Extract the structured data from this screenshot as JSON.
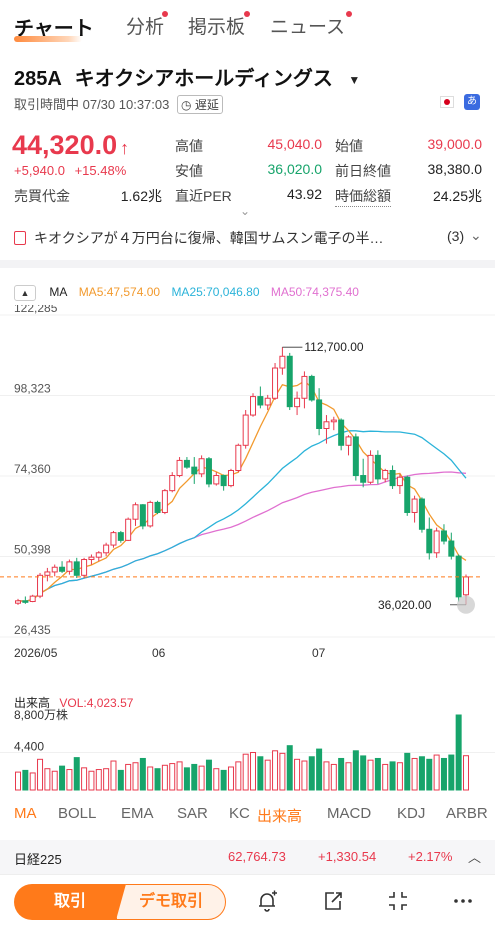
{
  "tabs": [
    {
      "label": "チャート",
      "active": true,
      "dot": false
    },
    {
      "label": "分析",
      "active": false,
      "dot": true
    },
    {
      "label": "掲示板",
      "active": false,
      "dot": true
    },
    {
      "label": "ニュース",
      "active": false,
      "dot": true
    }
  ],
  "stock": {
    "code": "285A",
    "name": "キオクシアホールディングス",
    "status": "取引時間中 07/30 10:37:03",
    "delay_label": "遅延",
    "price": "44,320.0",
    "change": "+5,940.0",
    "change_pct": "+15.48%",
    "turnover_label": "売買代金",
    "turnover": "1.62兆"
  },
  "stats": {
    "high_label": "高値",
    "high": "45,040.0",
    "open_label": "始値",
    "open": "39,000.0",
    "low_label": "安値",
    "low": "36,020.0",
    "prev_close_label": "前日終値",
    "prev_close": "38,380.0",
    "per_label": "直近PER",
    "per": "43.92",
    "mcap_label": "時価総額",
    "mcap": "24.25兆"
  },
  "news": {
    "text": "キオクシアが４万円台に復帰、韓国サムスン電子の半…",
    "count": "(3)"
  },
  "ma_legend": {
    "toggle": "MA",
    "ma5": "MA5:47,574.00",
    "ma25": "MA25:70,046.80",
    "ma50": "MA50:74,375.40"
  },
  "colors": {
    "up": "#e8394d",
    "down": "#17a46b",
    "ma5": "#f29a2e",
    "ma25": "#2bb3d9",
    "ma50": "#e070d0",
    "accent": "#ff7a1a"
  },
  "chart_data": {
    "type": "candlestick",
    "y_ticks": [
      "122,285",
      "98,323",
      "74,360",
      "50,398",
      "26,435"
    ],
    "x_ticks": [
      "2026/05",
      "06",
      "07"
    ],
    "max_label": "112,700.00",
    "min_label": "36,020.00",
    "last_price": 44320,
    "candles": [
      {
        "o": 36500,
        "h": 37800,
        "l": 36000,
        "c": 37200
      },
      {
        "o": 37200,
        "h": 38500,
        "l": 36300,
        "c": 37000
      },
      {
        "o": 37000,
        "h": 39000,
        "l": 36800,
        "c": 38600
      },
      {
        "o": 38600,
        "h": 45500,
        "l": 38000,
        "c": 44800
      },
      {
        "o": 44800,
        "h": 47000,
        "l": 43000,
        "c": 45800
      },
      {
        "o": 45800,
        "h": 48000,
        "l": 44500,
        "c": 47200
      },
      {
        "o": 47200,
        "h": 49000,
        "l": 45500,
        "c": 46000
      },
      {
        "o": 46000,
        "h": 49500,
        "l": 45000,
        "c": 48800
      },
      {
        "o": 48800,
        "h": 50000,
        "l": 44000,
        "c": 44800
      },
      {
        "o": 44800,
        "h": 50000,
        "l": 44000,
        "c": 49500
      },
      {
        "o": 49500,
        "h": 51000,
        "l": 48000,
        "c": 50200
      },
      {
        "o": 50200,
        "h": 52000,
        "l": 49000,
        "c": 51500
      },
      {
        "o": 51500,
        "h": 54500,
        "l": 50500,
        "c": 53800
      },
      {
        "o": 53800,
        "h": 58000,
        "l": 53000,
        "c": 57500
      },
      {
        "o": 57500,
        "h": 58000,
        "l": 54500,
        "c": 55200
      },
      {
        "o": 55200,
        "h": 62000,
        "l": 55000,
        "c": 61500
      },
      {
        "o": 61500,
        "h": 66500,
        "l": 59500,
        "c": 65800
      },
      {
        "o": 65800,
        "h": 66000,
        "l": 58500,
        "c": 59500
      },
      {
        "o": 59500,
        "h": 67000,
        "l": 59000,
        "c": 66500
      },
      {
        "o": 66500,
        "h": 67000,
        "l": 63000,
        "c": 63500
      },
      {
        "o": 63500,
        "h": 70500,
        "l": 63000,
        "c": 70000
      },
      {
        "o": 70000,
        "h": 75500,
        "l": 69500,
        "c": 74500
      },
      {
        "o": 74500,
        "h": 80000,
        "l": 74000,
        "c": 79000
      },
      {
        "o": 79000,
        "h": 80000,
        "l": 76500,
        "c": 77000
      },
      {
        "o": 77000,
        "h": 80000,
        "l": 72000,
        "c": 75000
      },
      {
        "o": 75000,
        "h": 80500,
        "l": 74000,
        "c": 79500
      },
      {
        "o": 79500,
        "h": 80000,
        "l": 71000,
        "c": 72000
      },
      {
        "o": 72000,
        "h": 75500,
        "l": 71500,
        "c": 74500
      },
      {
        "o": 74500,
        "h": 74800,
        "l": 70000,
        "c": 71500
      },
      {
        "o": 71500,
        "h": 76500,
        "l": 71000,
        "c": 76000
      },
      {
        "o": 76000,
        "h": 84000,
        "l": 75500,
        "c": 83500
      },
      {
        "o": 83500,
        "h": 94000,
        "l": 82500,
        "c": 92500
      },
      {
        "o": 92500,
        "h": 99000,
        "l": 92000,
        "c": 98000
      },
      {
        "o": 98000,
        "h": 101000,
        "l": 94500,
        "c": 95500
      },
      {
        "o": 95500,
        "h": 98500,
        "l": 94000,
        "c": 97500
      },
      {
        "o": 97500,
        "h": 108000,
        "l": 97000,
        "c": 106500
      },
      {
        "o": 106500,
        "h": 112700,
        "l": 104500,
        "c": 110000
      },
      {
        "o": 110000,
        "h": 111000,
        "l": 94000,
        "c": 95000
      },
      {
        "o": 95000,
        "h": 99500,
        "l": 92500,
        "c": 97500
      },
      {
        "o": 97500,
        "h": 105500,
        "l": 94500,
        "c": 104000
      },
      {
        "o": 104000,
        "h": 104500,
        "l": 96500,
        "c": 97000
      },
      {
        "o": 97000,
        "h": 100500,
        "l": 86500,
        "c": 88500
      },
      {
        "o": 88500,
        "h": 92500,
        "l": 84000,
        "c": 90500
      },
      {
        "o": 90500,
        "h": 92000,
        "l": 88000,
        "c": 91000
      },
      {
        "o": 91000,
        "h": 91500,
        "l": 82000,
        "c": 83500
      },
      {
        "o": 83500,
        "h": 86500,
        "l": 80500,
        "c": 86000
      },
      {
        "o": 86000,
        "h": 87000,
        "l": 73000,
        "c": 74500
      },
      {
        "o": 74500,
        "h": 79500,
        "l": 71000,
        "c": 72500
      },
      {
        "o": 72500,
        "h": 82000,
        "l": 72000,
        "c": 80500
      },
      {
        "o": 80500,
        "h": 82000,
        "l": 72000,
        "c": 73500
      },
      {
        "o": 73500,
        "h": 76500,
        "l": 72500,
        "c": 76000
      },
      {
        "o": 76000,
        "h": 77500,
        "l": 70500,
        "c": 71500
      },
      {
        "o": 71500,
        "h": 75000,
        "l": 69000,
        "c": 74000
      },
      {
        "o": 74000,
        "h": 74500,
        "l": 62500,
        "c": 63500
      },
      {
        "o": 63500,
        "h": 68500,
        "l": 60500,
        "c": 67500
      },
      {
        "o": 67500,
        "h": 68000,
        "l": 57500,
        "c": 58500
      },
      {
        "o": 58500,
        "h": 62000,
        "l": 49500,
        "c": 51500
      },
      {
        "o": 51500,
        "h": 59000,
        "l": 50000,
        "c": 58000
      },
      {
        "o": 58000,
        "h": 60000,
        "l": 54000,
        "c": 55000
      },
      {
        "o": 55000,
        "h": 57500,
        "l": 49500,
        "c": 50500
      },
      {
        "o": 50500,
        "h": 51000,
        "l": 37000,
        "c": 38380
      },
      {
        "o": 39000,
        "h": 45040,
        "l": 36020,
        "c": 44320
      }
    ],
    "volume_title": "出来高",
    "volume_label": "VOL:4,023.57",
    "volume_ticks": [
      "8,800万株",
      "4,400"
    ],
    "volumes": [
      2100,
      2300,
      2000,
      3600,
      2500,
      2200,
      2800,
      2400,
      3800,
      2600,
      2200,
      2400,
      2500,
      3400,
      2300,
      3000,
      3200,
      3700,
      2700,
      2500,
      2900,
      3100,
      3300,
      2600,
      3000,
      2800,
      3500,
      2500,
      2300,
      2700,
      3300,
      4200,
      4400,
      3900,
      3500,
      4600,
      4300,
      5200,
      3600,
      3400,
      3900,
      4800,
      3300,
      3000,
      3700,
      3200,
      4600,
      4000,
      3500,
      3700,
      3000,
      3300,
      3200,
      4300,
      3700,
      3900,
      3600,
      4100,
      3700,
      4100,
      8800,
      4023.57
    ]
  },
  "indicator_tabs": [
    "MA",
    "BOLL",
    "EMA",
    "SAR",
    "KC",
    "出来高",
    "MACD",
    "KDJ",
    "ARBR"
  ],
  "nikkei": {
    "label": "日経225",
    "value": "62,764.73",
    "change": "+1,330.54",
    "pct": "+2.17%"
  },
  "bottom": {
    "trade": "取引",
    "demo": "デモ取引"
  }
}
